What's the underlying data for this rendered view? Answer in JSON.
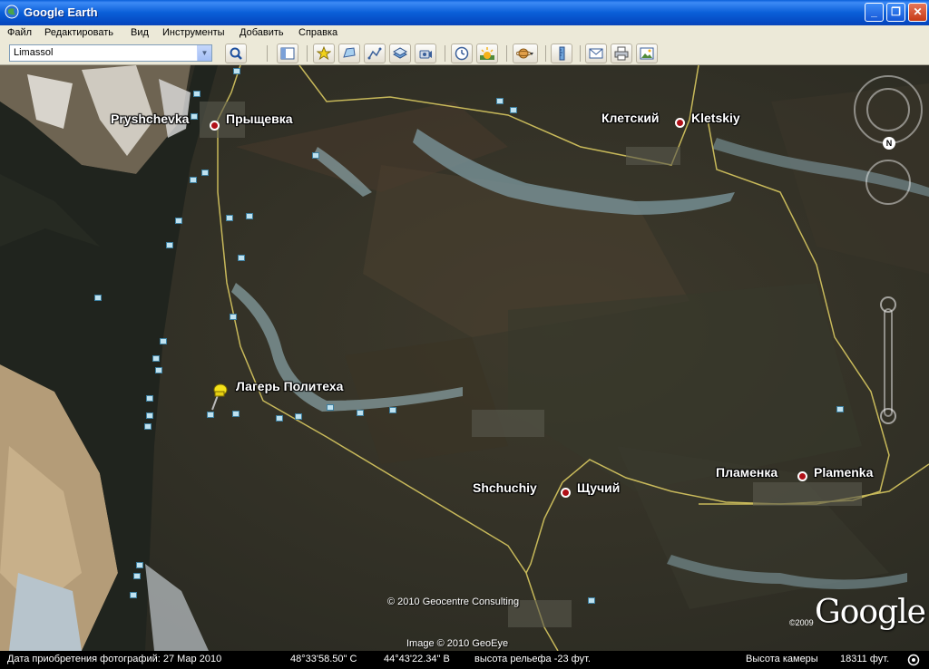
{
  "window": {
    "title": "Google Earth",
    "min_glyph": "_",
    "max_glyph": "❐",
    "close_glyph": "✕"
  },
  "menu": [
    "Файл",
    "Редактировать",
    "Вид",
    "Инструменты",
    "Добавить",
    "Справка"
  ],
  "search": {
    "value": "Limassol"
  },
  "toolbar_icons": [
    "sidebar-icon",
    "placemark-icon",
    "polygon-icon",
    "path-icon",
    "image-overlay-icon",
    "record-tour-icon",
    "historical-imagery-icon",
    "sunlight-icon",
    "planets-icon",
    "ruler-icon",
    "email-icon",
    "print-icon",
    "save-image-icon"
  ],
  "places": {
    "pryshchevka": "Pryshchevka",
    "pryshchevka_ru": "Прыщевка",
    "kletskiy_ru": "Клетский",
    "kletskiy": "Kletskiy",
    "lager": "Лагерь Политеха",
    "shchuchiy": "Shchuchiy",
    "shchuchiy_ru": "Щучий",
    "plamenka_ru": "Пламенка",
    "plamenka": "Plamenka"
  },
  "copyright": {
    "geocentre": "© 2010 Geocentre Consulting",
    "geoeye": "Image © 2010 GeoEye",
    "google_year": "©2009",
    "google_logo": "Google"
  },
  "compass": {
    "north": "N"
  },
  "status": {
    "acquired": "Дата приобретения фотографий: 27 Мар 2010",
    "lat": "48°33'58.50\" С",
    "lon": "44°43'22.34\" В",
    "elevation": "высота рельефа  -23 фут.",
    "camera_label": "Высота камеры",
    "camera_value": "18311 фут."
  },
  "colors": {
    "road": "#d8c860",
    "river": "#2a3028",
    "sand": "#b49c78",
    "pin": "#f4e21a"
  }
}
